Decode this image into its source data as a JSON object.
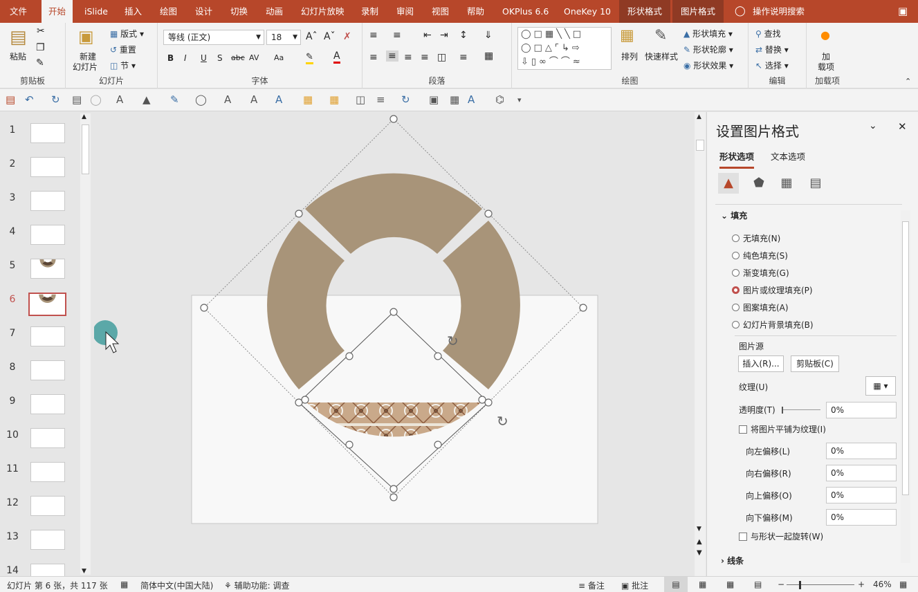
{
  "tabs": [
    "文件",
    "开始",
    "iSlide",
    "插入",
    "绘图",
    "设计",
    "切换",
    "动画",
    "幻灯片放映",
    "录制",
    "审阅",
    "视图",
    "帮助",
    "OKPlus 6.6",
    "OneKey 10",
    "形状格式",
    "图片格式"
  ],
  "tell_me": "操作说明搜索",
  "ribbon": {
    "clipboard": {
      "paste": "粘贴",
      "label": "剪贴板"
    },
    "slides": {
      "new_slide_1": "新建",
      "new_slide_2": "幻灯片",
      "layout": "版式",
      "reset": "重置",
      "section": "节",
      "label": "幻灯片"
    },
    "font": {
      "name": "等线 (正文)",
      "size": "18",
      "label": "字体",
      "bold": "B",
      "italic": "I",
      "underline": "U",
      "shadow": "S",
      "strike": "abc",
      "spacing": "AV",
      "case": "Aa"
    },
    "paragraph": {
      "label": "段落"
    },
    "drawing": {
      "arrange": "排列",
      "quick_styles": "快速样式",
      "shape_fill": "形状填充",
      "shape_outline": "形状轮廓",
      "shape_effect": "形状效果",
      "label": "绘图"
    },
    "editing": {
      "find": "查找",
      "replace": "替换",
      "select": "选择",
      "label": "编辑"
    },
    "addins": {
      "addin_1": "加",
      "addin_2": "载项",
      "label": "加载项"
    }
  },
  "thumbnails": [
    "1",
    "2",
    "3",
    "4",
    "5",
    "6",
    "7",
    "8",
    "9",
    "10",
    "11",
    "12",
    "13",
    "14"
  ],
  "format_pane": {
    "title": "设置图片格式",
    "tab_shape": "形状选项",
    "tab_text": "文本选项",
    "section_fill": "填充",
    "options": [
      "无填充(N)",
      "纯色填充(S)",
      "渐变填充(G)",
      "图片或纹理填充(P)",
      "图案填充(A)",
      "幻灯片背景填充(B)"
    ],
    "picture_source": "图片源",
    "insert_btn": "插入(R)...",
    "clipboard_btn": "剪贴板(C)",
    "texture": "纹理(U)",
    "transparency": "透明度(T)",
    "transparency_val": "0%",
    "tile": "将图片平铺为纹理(I)",
    "offset_left": "向左偏移(L)",
    "offset_right": "向右偏移(R)",
    "offset_top": "向上偏移(O)",
    "offset_bottom": "向下偏移(M)",
    "offset_left_val": "0%",
    "offset_right_val": "0%",
    "offset_top_val": "0%",
    "offset_bottom_val": "0%",
    "rotate_with_shape": "与形状一起旋转(W)",
    "section_line": "线条"
  },
  "status": {
    "slide_info": "幻灯片 第 6 张，共 117 张",
    "language": "简体中文(中国大陆)",
    "accessibility": "辅助功能: 调查",
    "notes": "备注",
    "comments": "批注",
    "zoom": "46%"
  },
  "colors": {
    "accent": "#b7472a",
    "ring": "#a89479",
    "selection": "#c0504d",
    "cursor_dot": "#5ba8a8"
  }
}
